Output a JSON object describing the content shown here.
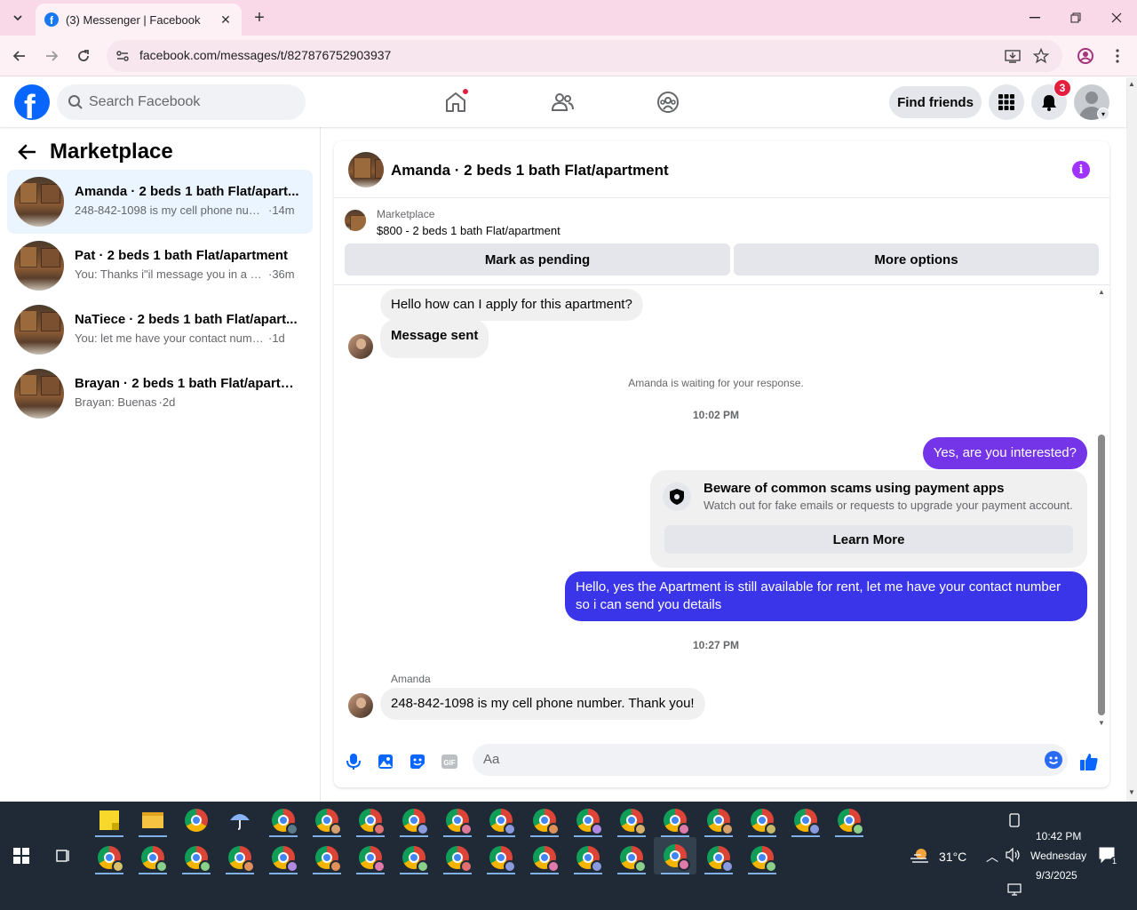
{
  "browser": {
    "tab_title": "(3) Messenger | Facebook",
    "url": "facebook.com/messages/t/827876752903937"
  },
  "header": {
    "search_placeholder": "Search Facebook",
    "find_friends": "Find friends",
    "notification_count": "3"
  },
  "sidebar": {
    "title": "Marketplace",
    "conversations": [
      {
        "name": "Amanda · 2 beds 1 bath Flat/apart...",
        "preview": "248-842-1098 is my cell phone num...",
        "time": "·14m",
        "active": true
      },
      {
        "name": "Pat · 2 beds 1 bath Flat/apartment",
        "preview": "You: Thanks i\"il message you in a m...",
        "time": "·36m",
        "active": false
      },
      {
        "name": "NaTiece · 2 beds 1 bath Flat/apart...",
        "preview": "You: let me have your contact number...",
        "time": "·1d",
        "active": false
      },
      {
        "name": "Brayan · 2 beds 1 bath Flat/apartm...",
        "preview": "Brayan: Buenas",
        "time": "·2d",
        "active": false
      }
    ]
  },
  "chat": {
    "title": "Amanda · 2 beds 1 bath Flat/apartment",
    "listing_label": "Marketplace",
    "listing_price": "$800 - 2 beds 1 bath Flat/apartment",
    "mark_pending": "Mark as pending",
    "more_options": "More options",
    "messages": {
      "in1": "Hello how can I apply for this apartment?",
      "in2": "Message sent",
      "waiting": "Amanda is waiting for your response.",
      "time1": "10:02 PM",
      "out1": "Yes, are you interested?",
      "scam_title": "Beware of common scams using payment apps",
      "scam_desc": "Watch out for fake emails or requests to upgrade your payment account.",
      "learn_more": "Learn More",
      "out2": "Hello, yes the Apartment is still available for rent, let me have your contact number so i can send you details",
      "time2": "10:27 PM",
      "sender": "Amanda",
      "in3": "248-842-1098 is my cell phone number. Thank you!"
    },
    "composer_placeholder": "Aa"
  },
  "taskbar": {
    "weather": "31°C",
    "time": "10:42 PM",
    "day": "Wednesday",
    "date": "9/3/2025",
    "notif_count": "1"
  },
  "colors": {
    "fb_blue": "#0866ff",
    "outgoing_bubble": "#7434e8",
    "outgoing_bubble_2": "#3a35e8",
    "badge_red": "#e41e3f"
  }
}
